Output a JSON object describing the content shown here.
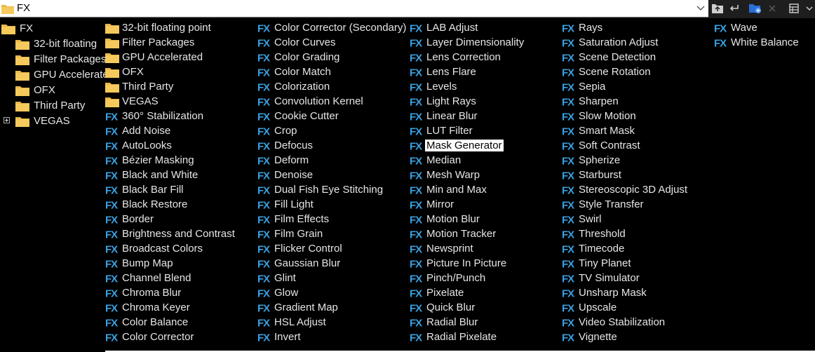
{
  "toolbar": {
    "path": "FX"
  },
  "tree": {
    "root": "FX",
    "children": [
      "32-bit floating point",
      "Filter Packages",
      "GPU Accelerated",
      "OFX",
      "Third Party",
      "VEGAS"
    ],
    "display": [
      "32-bit floating",
      "Filter Packages",
      "GPU Accelerate",
      "OFX",
      "Third Party",
      "VEGAS"
    ]
  },
  "list": {
    "selected": "Mask Generator",
    "columns": [
      [
        {
          "type": "folder",
          "label": "32-bit floating point"
        },
        {
          "type": "folder",
          "label": "Filter Packages"
        },
        {
          "type": "folder",
          "label": "GPU Accelerated"
        },
        {
          "type": "folder",
          "label": "OFX"
        },
        {
          "type": "folder",
          "label": "Third Party"
        },
        {
          "type": "folder",
          "label": "VEGAS"
        },
        {
          "type": "fx",
          "label": "360° Stabilization"
        },
        {
          "type": "fx",
          "label": "Add Noise"
        },
        {
          "type": "fx",
          "label": "AutoLooks"
        },
        {
          "type": "fx",
          "label": "Bézier Masking"
        },
        {
          "type": "fx",
          "label": "Black and White"
        },
        {
          "type": "fx",
          "label": "Black Bar Fill"
        },
        {
          "type": "fx",
          "label": "Black Restore"
        },
        {
          "type": "fx",
          "label": "Border"
        },
        {
          "type": "fx",
          "label": "Brightness and Contrast"
        },
        {
          "type": "fx",
          "label": "Broadcast Colors"
        },
        {
          "type": "fx",
          "label": "Bump Map"
        },
        {
          "type": "fx",
          "label": "Channel Blend"
        },
        {
          "type": "fx",
          "label": "Chroma Blur"
        },
        {
          "type": "fx",
          "label": "Chroma Keyer"
        },
        {
          "type": "fx",
          "label": "Color Balance"
        },
        {
          "type": "fx",
          "label": "Color Corrector"
        }
      ],
      [
        {
          "type": "fx",
          "label": "Color Corrector (Secondary)"
        },
        {
          "type": "fx",
          "label": "Color Curves"
        },
        {
          "type": "fx",
          "label": "Color Grading"
        },
        {
          "type": "fx",
          "label": "Color Match"
        },
        {
          "type": "fx",
          "label": "Colorization"
        },
        {
          "type": "fx",
          "label": "Convolution Kernel"
        },
        {
          "type": "fx",
          "label": "Cookie Cutter"
        },
        {
          "type": "fx",
          "label": "Crop"
        },
        {
          "type": "fx",
          "label": "Defocus"
        },
        {
          "type": "fx",
          "label": "Deform"
        },
        {
          "type": "fx",
          "label": "Denoise"
        },
        {
          "type": "fx",
          "label": "Dual Fish Eye Stitching"
        },
        {
          "type": "fx",
          "label": "Fill Light"
        },
        {
          "type": "fx",
          "label": "Film Effects"
        },
        {
          "type": "fx",
          "label": "Film Grain"
        },
        {
          "type": "fx",
          "label": "Flicker Control"
        },
        {
          "type": "fx",
          "label": "Gaussian Blur"
        },
        {
          "type": "fx",
          "label": "Glint"
        },
        {
          "type": "fx",
          "label": "Glow"
        },
        {
          "type": "fx",
          "label": "Gradient Map"
        },
        {
          "type": "fx",
          "label": "HSL Adjust"
        },
        {
          "type": "fx",
          "label": "Invert"
        }
      ],
      [
        {
          "type": "fx",
          "label": "LAB Adjust"
        },
        {
          "type": "fx",
          "label": "Layer Dimensionality"
        },
        {
          "type": "fx",
          "label": "Lens Correction"
        },
        {
          "type": "fx",
          "label": "Lens Flare"
        },
        {
          "type": "fx",
          "label": "Levels"
        },
        {
          "type": "fx",
          "label": "Light Rays"
        },
        {
          "type": "fx",
          "label": "Linear Blur"
        },
        {
          "type": "fx",
          "label": "LUT Filter"
        },
        {
          "type": "fx",
          "label": "Mask Generator"
        },
        {
          "type": "fx",
          "label": "Median"
        },
        {
          "type": "fx",
          "label": "Mesh Warp"
        },
        {
          "type": "fx",
          "label": "Min and Max"
        },
        {
          "type": "fx",
          "label": "Mirror"
        },
        {
          "type": "fx",
          "label": "Motion Blur"
        },
        {
          "type": "fx",
          "label": "Motion Tracker"
        },
        {
          "type": "fx",
          "label": "Newsprint"
        },
        {
          "type": "fx",
          "label": "Picture In Picture"
        },
        {
          "type": "fx",
          "label": "Pinch/Punch"
        },
        {
          "type": "fx",
          "label": "Pixelate"
        },
        {
          "type": "fx",
          "label": "Quick Blur"
        },
        {
          "type": "fx",
          "label": "Radial Blur"
        },
        {
          "type": "fx",
          "label": "Radial Pixelate"
        }
      ],
      [
        {
          "type": "fx",
          "label": "Rays"
        },
        {
          "type": "fx",
          "label": "Saturation Adjust"
        },
        {
          "type": "fx",
          "label": "Scene Detection"
        },
        {
          "type": "fx",
          "label": "Scene Rotation"
        },
        {
          "type": "fx",
          "label": "Sepia"
        },
        {
          "type": "fx",
          "label": "Sharpen"
        },
        {
          "type": "fx",
          "label": "Slow Motion"
        },
        {
          "type": "fx",
          "label": "Smart Mask"
        },
        {
          "type": "fx",
          "label": "Soft Contrast"
        },
        {
          "type": "fx",
          "label": "Spherize"
        },
        {
          "type": "fx",
          "label": "Starburst"
        },
        {
          "type": "fx",
          "label": "Stereoscopic 3D Adjust"
        },
        {
          "type": "fx",
          "label": "Style Transfer"
        },
        {
          "type": "fx",
          "label": "Swirl"
        },
        {
          "type": "fx",
          "label": "Threshold"
        },
        {
          "type": "fx",
          "label": "Timecode"
        },
        {
          "type": "fx",
          "label": "Tiny Planet"
        },
        {
          "type": "fx",
          "label": "TV Simulator"
        },
        {
          "type": "fx",
          "label": "Unsharp Mask"
        },
        {
          "type": "fx",
          "label": "Upscale"
        },
        {
          "type": "fx",
          "label": "Video Stabilization"
        },
        {
          "type": "fx",
          "label": "Vignette"
        }
      ],
      [
        {
          "type": "fx",
          "label": "Wave"
        },
        {
          "type": "fx",
          "label": "White Balance"
        }
      ]
    ]
  },
  "colors": {
    "background": "#000000",
    "text": "#e6e6e6",
    "fx_icon": "#3aa0e0",
    "folder": "#e8b84a",
    "selection_bg": "#ffffff"
  },
  "icons": {
    "path_folder": "folder-icon",
    "dropdown": "chevron-down-icon",
    "toolbar": [
      "folder-up-icon",
      "back-icon",
      "new-folder-icon",
      "delete-icon",
      "view-mode-icon"
    ]
  }
}
